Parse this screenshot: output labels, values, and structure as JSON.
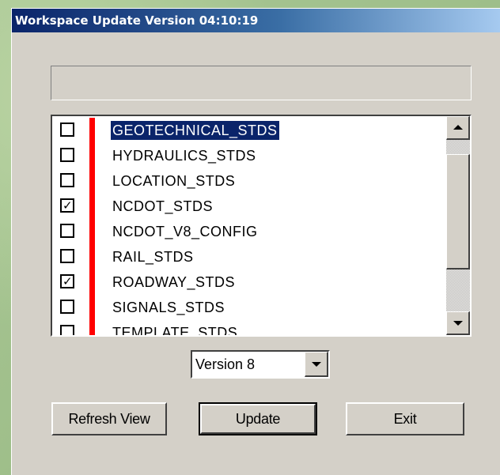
{
  "window": {
    "title": "Workspace Update Version 04:10:19",
    "status_text": ""
  },
  "list": {
    "items": [
      {
        "label": "GEOTECHNICAL_STDS",
        "checked": false,
        "selected": true
      },
      {
        "label": "HYDRAULICS_STDS",
        "checked": false,
        "selected": false
      },
      {
        "label": "LOCATION_STDS",
        "checked": false,
        "selected": false
      },
      {
        "label": "NCDOT_STDS",
        "checked": true,
        "selected": false
      },
      {
        "label": "NCDOT_V8_CONFIG",
        "checked": false,
        "selected": false
      },
      {
        "label": "RAIL_STDS",
        "checked": false,
        "selected": false
      },
      {
        "label": "ROADWAY_STDS",
        "checked": true,
        "selected": false
      },
      {
        "label": "SIGNALS_STDS",
        "checked": false,
        "selected": false
      },
      {
        "label": "TEMPLATE_STDS",
        "checked": false,
        "selected": false
      }
    ],
    "marker_color": "#ff0000",
    "selection_color": "#0a246a"
  },
  "version_select": {
    "value": "Version 8"
  },
  "buttons": {
    "refresh_label": "Refresh View",
    "update_label": "Update",
    "exit_label": "Exit"
  },
  "icons": {
    "scroll_up": "triangle-up-icon",
    "scroll_down": "triangle-down-icon",
    "dropdown": "triangle-down-icon",
    "checkmark": "check-icon"
  }
}
